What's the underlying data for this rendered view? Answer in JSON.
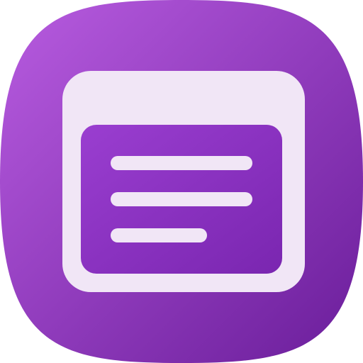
{
  "app_icon": {
    "icon_name": "document-window-icon",
    "colors": {
      "gradient_start": "#b85ce0",
      "gradient_end": "#6a1d9a",
      "panel": "#f1e6f6",
      "content": "#8a30c0",
      "lines": "#f1e6f6"
    },
    "text_lines": 3
  }
}
